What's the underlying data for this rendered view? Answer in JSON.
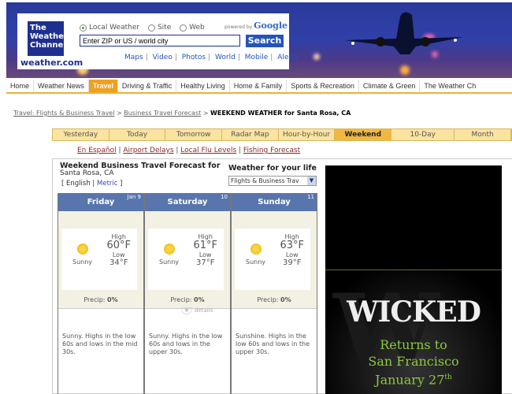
{
  "header": {
    "logo_lines": [
      "The",
      "Weather",
      "Channel"
    ],
    "site": "weather.com",
    "radios": [
      {
        "label": "Local Weather",
        "checked": true
      },
      {
        "label": "Site",
        "checked": false
      },
      {
        "label": "Web",
        "checked": false
      }
    ],
    "powered_by": "powered by",
    "google": "Google",
    "search_placeholder": "Enter ZIP or US / world city",
    "search_button": "Search",
    "links": [
      "Maps",
      "Video",
      "Photos",
      "World",
      "Mobile",
      "Alerts"
    ]
  },
  "nav": [
    "Home",
    "Weather News",
    "Travel",
    "Driving & Traffic",
    "Healthy Living",
    "Home & Family",
    "Sports & Recreation",
    "Climate & Green",
    "The Weather Ch"
  ],
  "nav_active": "Travel",
  "breadcrumb": {
    "items": [
      "Travel: Flights & Business Travel",
      "Business Travel Forecast"
    ],
    "sep": ">",
    "current": "WEEKEND WEATHER for Santa Rosa, CA"
  },
  "tabs": [
    "Yesterday",
    "Today",
    "Tomorrow",
    "Radar Map",
    "Hour-by-Hour",
    "Weekend",
    "10-Day",
    "Month"
  ],
  "tab_active": "Weekend",
  "sublinks": [
    "En Español",
    "Airport Delays",
    "Local Flu Levels",
    "Fishing Forecast"
  ],
  "panel": {
    "title": "Weekend Business Travel Forecast for",
    "city": "Santa Rosa, CA",
    "lang_open": "[",
    "english": "English",
    "metric": "Metric",
    "lang_close": "]",
    "wfyl": "Weather for your life",
    "select_value": "Flights & Business Trav",
    "details": "details"
  },
  "days": [
    {
      "name": "Friday",
      "date": "Jan 9",
      "cond": "Sunny",
      "high_label": "High",
      "high": "60°F",
      "low_label": "Low",
      "low": "34°F",
      "precip_label": "Precip:",
      "precip": "0%",
      "desc": "Sunny. Highs in the low 60s and lows in the mid 30s."
    },
    {
      "name": "Saturday",
      "date": "10",
      "cond": "Sunny",
      "high_label": "High",
      "high": "61°F",
      "low_label": "Low",
      "low": "37°F",
      "precip_label": "Precip:",
      "precip": "0%",
      "desc": "Sunny. Highs in the low 60s and lows in the upper 30s."
    },
    {
      "name": "Sunday",
      "date": "11",
      "cond": "Sunny",
      "high_label": "High",
      "high": "63°F",
      "low_label": "Low",
      "low": "39°F",
      "precip_label": "Precip:",
      "precip": "0%",
      "desc": "Sunshine. Highs in the low 60s and lows in the upper 30s."
    }
  ],
  "ad": {
    "title": "WICKED",
    "line1": "Returns to",
    "line2": "San Francisco",
    "line3": "January 27",
    "sup": "th"
  },
  "colors": {
    "nav_active": "#f0a020",
    "tab_active": "#f0b840",
    "day_header": "#5875ad",
    "ad_green": "#8cc840"
  }
}
